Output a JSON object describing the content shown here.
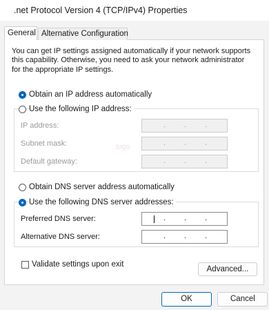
{
  "window": {
    "title": ".net Protocol Version 4 (TCP/IPv4) Properties"
  },
  "tabs": [
    {
      "label": "General",
      "selected": true
    },
    {
      "label": "Alternative Configuration",
      "selected": false
    }
  ],
  "intro_text": "You can get IP settings assigned automatically if your network supports this capability. Otherwise, you need to ask your network administrator for the appropriate IP settings.",
  "ip": {
    "auto_label": "Obtain an IP address automatically",
    "auto_selected": true,
    "manual_label": "Use the following IP address:",
    "manual_selected": false,
    "fields": [
      {
        "label": "IP address:",
        "value": ". . .",
        "enabled": false
      },
      {
        "label": "Subnet mask:",
        "value": ". . .",
        "enabled": false
      },
      {
        "label": "Default gateway:",
        "value": ". . .",
        "enabled": false
      }
    ]
  },
  "dns": {
    "auto_label": "Obtain DNS server address automatically",
    "auto_selected": false,
    "manual_label": "Use the following DNS server addresses:",
    "manual_selected": true,
    "fields": [
      {
        "label": "Preferred DNS server:",
        "value": ". . .",
        "enabled": true,
        "focused": true
      },
      {
        "label": "Alternative DNS server:",
        "value": ". . .",
        "enabled": true
      }
    ]
  },
  "validate": {
    "label": "Validate settings upon exit",
    "checked": false
  },
  "buttons": {
    "advanced": "Advanced...",
    "ok": "OK",
    "cancel": "Cancel"
  },
  "watermark": "logo",
  "colors": {
    "accent": "#0067c0",
    "panel": "#ffffff",
    "background": "#f3f3f3"
  }
}
